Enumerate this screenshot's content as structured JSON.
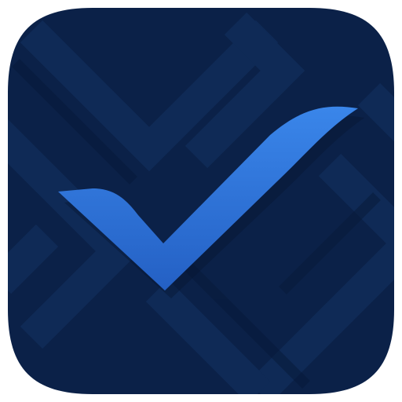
{
  "icon": {
    "name": "checkmark-app-icon",
    "background_color": "#0b2148",
    "pattern_color": "#0f2a56",
    "pattern_shadow_color": "#081a3a",
    "checkmark_color_top": "#3a86ea",
    "checkmark_color_bottom": "#2460c4"
  }
}
